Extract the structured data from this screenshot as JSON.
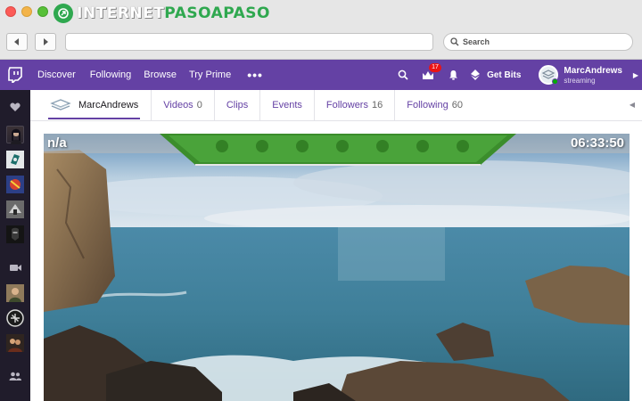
{
  "site_logo": {
    "text_main": "INTERNET",
    "text_accent": "PASOAPASO"
  },
  "browser": {
    "search_placeholder": "Search",
    "back_icon": "back-arrow-icon",
    "forward_icon": "forward-arrow-icon"
  },
  "topnav": {
    "items": [
      "Discover",
      "Following",
      "Browse",
      "Try Prime"
    ],
    "more": "•••",
    "notifications_badge": "17",
    "get_bits": "Get Bits",
    "user": {
      "name": "MarcAndrews",
      "status": "streaming"
    },
    "accent_color": "#6441a4"
  },
  "channel": {
    "name": "MarcAndrews",
    "tabs": [
      {
        "label": "Videos",
        "count": "0"
      },
      {
        "label": "Clips",
        "count": ""
      },
      {
        "label": "Events",
        "count": ""
      },
      {
        "label": "Followers",
        "count": "16"
      },
      {
        "label": "Following",
        "count": "60"
      }
    ]
  },
  "video": {
    "title": "n/a",
    "timer": "06:33:50"
  }
}
